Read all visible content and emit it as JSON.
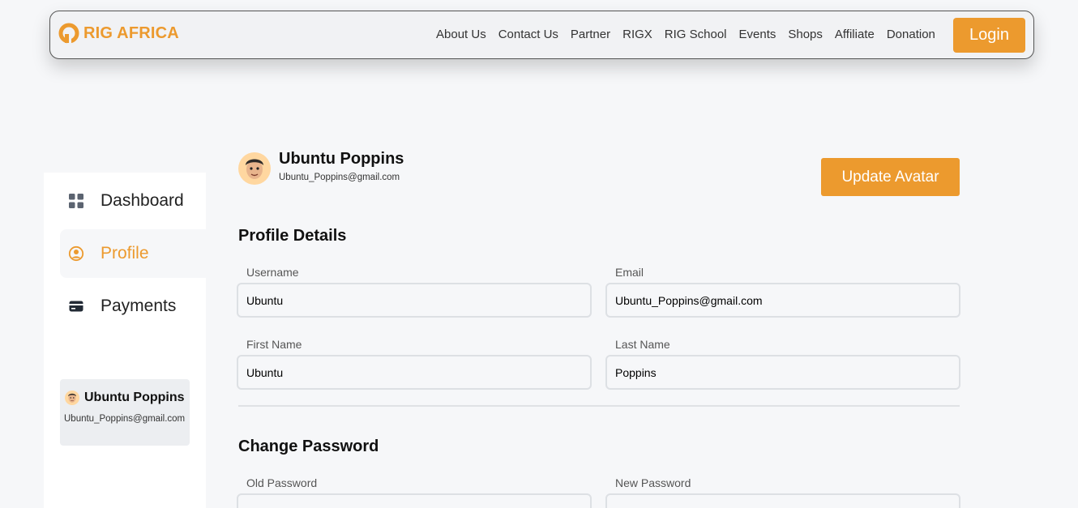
{
  "navbar": {
    "logo_text": "RIG AFRICA",
    "links": [
      "About Us",
      "Contact Us",
      "Partner",
      "RIGX",
      "RIG School",
      "Events",
      "Shops",
      "Affiliate",
      "Donation"
    ],
    "login_label": "Login"
  },
  "sidebar": {
    "items": [
      {
        "label": "Dashboard",
        "icon": "grid-icon",
        "active": false
      },
      {
        "label": "Profile",
        "icon": "user-circle-icon",
        "active": true
      },
      {
        "label": "Payments",
        "icon": "credit-card-icon",
        "active": false
      }
    ],
    "user_card": {
      "name": "Ubuntu Poppins",
      "email": "Ubuntu_Poppins@gmail.com"
    }
  },
  "profile": {
    "name": "Ubuntu Poppins",
    "email": "Ubuntu_Poppins@gmail.com",
    "update_avatar_label": "Update Avatar"
  },
  "profile_details": {
    "title": "Profile Details",
    "username_label": "Username",
    "username_value": "Ubuntu",
    "email_label": "Email",
    "email_value": "Ubuntu_Poppins@gmail.com",
    "first_name_label": "First Name",
    "first_name_value": "Ubuntu",
    "last_name_label": "Last Name",
    "last_name_value": "Poppins"
  },
  "change_password": {
    "title": "Change Password",
    "old_label": "Old Password",
    "new_label": "New Password"
  },
  "colors": {
    "accent": "#ec9a2e",
    "background": "#f6f7f9"
  }
}
